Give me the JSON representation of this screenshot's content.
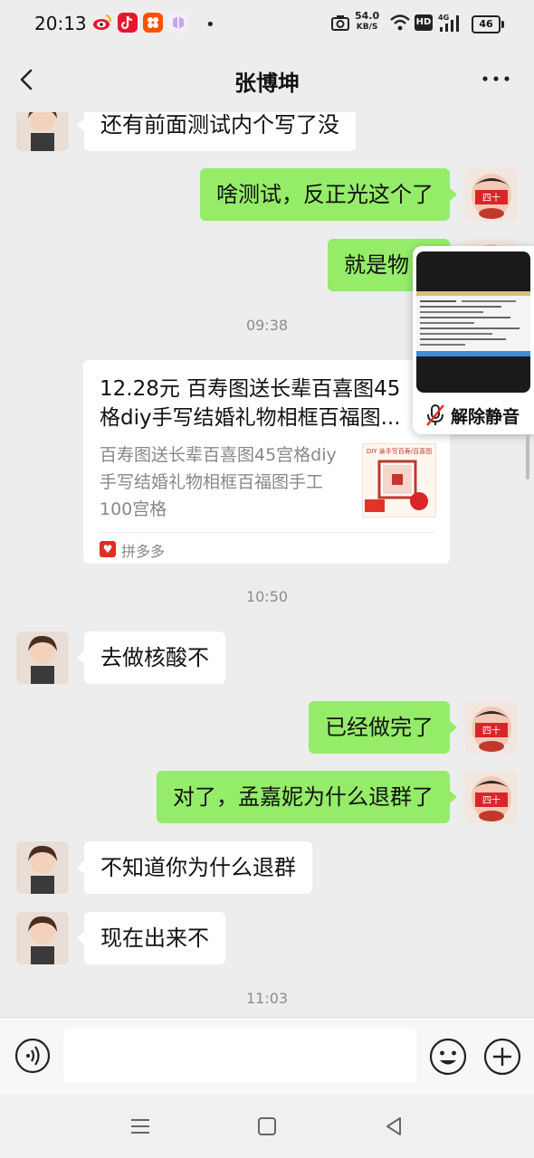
{
  "status_bar": {
    "time": "20:13",
    "net_speed_value": "54.0",
    "net_speed_unit": "KB/S",
    "battery": "46",
    "dot": "•",
    "app_icons": [
      "weibo-icon",
      "douyin-icon",
      "taobao-icon",
      "miniapp-icon"
    ],
    "system_icons": [
      "camera-icon",
      "wifi-icon",
      "hd-icon",
      "4g-signal-icon"
    ]
  },
  "header": {
    "title": "张博坤"
  },
  "messages": [
    {
      "side": "in",
      "text": "还有前面测试内个写了没"
    },
    {
      "side": "out",
      "text": "啥测试，反正光这个了"
    },
    {
      "side": "out",
      "text": "就是物"
    },
    {
      "type": "time",
      "text": "09:38"
    },
    {
      "side": "in",
      "type": "link",
      "title_line1": "12.28元 百寿图送长辈百喜图45",
      "title_line2": "格diy手写结婚礼物相框百福图...",
      "desc": "百寿图送长辈百喜图45宫格diy手写结婚礼物相框百福图手工100宫格",
      "source": "拼多多",
      "thumb_top": "DIY 亲手写百寿/百喜图"
    },
    {
      "type": "time",
      "text": "10:50"
    },
    {
      "side": "in",
      "text": "去做核酸不"
    },
    {
      "side": "out",
      "text": "已经做完了"
    },
    {
      "side": "out",
      "text": "对了，孟嘉妮为什么退群了"
    },
    {
      "side": "in",
      "text": "不知道你为什么退群"
    },
    {
      "side": "in",
      "text": "现在出来不"
    },
    {
      "type": "time",
      "text": "11:03"
    }
  ],
  "float_window": {
    "label": "解除静音"
  },
  "input_bar": {
    "placeholder": ""
  },
  "colors": {
    "outgoing_bubble": "#95ec69",
    "incoming_bubble": "#ffffff",
    "background": "#ededed",
    "pinduoduo_red": "#e02e24"
  }
}
